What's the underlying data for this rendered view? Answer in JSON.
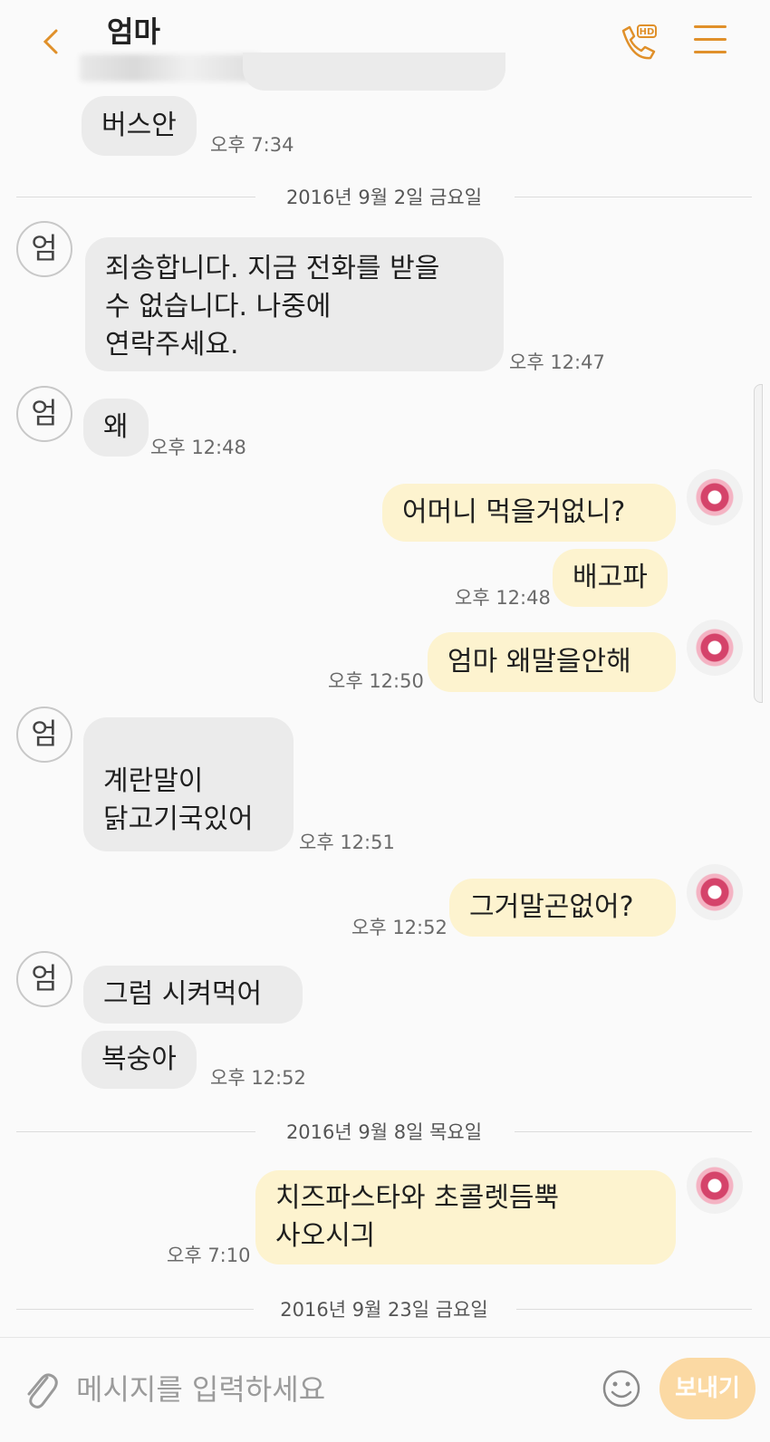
{
  "header": {
    "title": "엄마",
    "back_icon": "chevron-left-icon",
    "call_icon": "hd-call-icon",
    "menu_icon": "hamburger-menu-icon",
    "accent": "#e0902a"
  },
  "avatar_label": "엄",
  "messages": {
    "m1": {
      "text": "버스안",
      "time": "오후 7:34"
    },
    "d1": "2016년 9월 2일 금요일",
    "m2": {
      "text": "죄송합니다. 지금 전화를 받을\n수 없습니다. 나중에\n연락주세요.",
      "time": "오후 12:47"
    },
    "m3": {
      "text": "왜",
      "time": "오후 12:48"
    },
    "m4": {
      "text": "어머니 먹을거없니?"
    },
    "m5": {
      "text": "배고파",
      "time": "오후 12:48"
    },
    "m6": {
      "text": "엄마 왜말을안해",
      "time": "오후 12:50"
    },
    "m7": {
      "text": "계란말이\n닭고기국있어",
      "time": "오후 12:51"
    },
    "m8": {
      "text": "그거말곤없어?",
      "time": "오후 12:52"
    },
    "m9": {
      "text": "그럼 시켜먹어"
    },
    "m10": {
      "text": "복숭아",
      "time": "오후 12:52"
    },
    "d2": "2016년 9월 8일 목요일",
    "m11": {
      "text": "치즈파스타와 초콜렛듬뿍\n사오시긔",
      "time": "오후 7:10"
    },
    "d3": "2016년 9월 23일 금요일"
  },
  "input": {
    "placeholder": "메시지를 입력하세요",
    "send_label": "보내기",
    "attach_icon": "paperclip-icon",
    "emoji_icon": "smiley-icon"
  },
  "colors": {
    "incoming_bubble": "#ebebeb",
    "outgoing_bubble": "#fdf3cf",
    "send_button": "#fbd9a3"
  }
}
